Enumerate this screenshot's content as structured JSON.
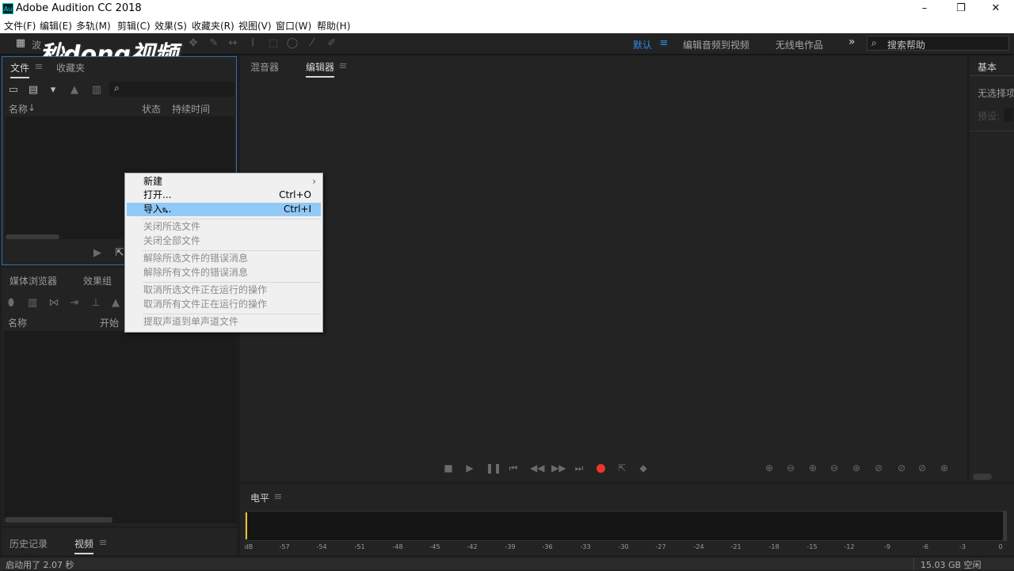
{
  "window": {
    "title": "Adobe Audition CC 2018",
    "app_icon": "Au",
    "minimize": "–",
    "maximize": "❐",
    "close": "✕"
  },
  "menu": [
    "文件(F)",
    "编辑(E)",
    "多轨(M)",
    "剪辑(C)",
    "效果(S)",
    "收藏夹(R)",
    "视图(V)",
    "窗口(W)",
    "帮助(H)"
  ],
  "toolbar": {
    "waveform_label": "波",
    "workspaces": [
      "默认",
      "编辑音频到视频",
      "无线电作品"
    ],
    "overflow": "»",
    "search_placeholder": "搜索帮助"
  },
  "watermark": "秒dong视频",
  "files_panel": {
    "tabs": [
      "文件",
      "收藏夹"
    ],
    "columns": [
      "名称",
      "状态",
      "持续时间"
    ]
  },
  "media_panel": {
    "tabs": [
      "媒体浏览器",
      "效果组"
    ],
    "columns": [
      "名称",
      "开始"
    ]
  },
  "history_panel": {
    "tabs": [
      "历史记录",
      "视频"
    ]
  },
  "editor_panel": {
    "tabs": [
      "混音器",
      "编辑器"
    ]
  },
  "essential_panel": {
    "title": "基本",
    "no_selection": "无选择项",
    "preset": "预设:"
  },
  "level_panel": {
    "title": "电平",
    "ticks": [
      "dB",
      "-57",
      "-54",
      "-51",
      "-48",
      "-45",
      "-42",
      "-39",
      "-36",
      "-33",
      "-30",
      "-27",
      "-24",
      "-21",
      "-18",
      "-15",
      "-12",
      "-9",
      "-6",
      "-3",
      "0"
    ]
  },
  "context_menu": {
    "items": [
      {
        "label": "新建",
        "shortcut": "›",
        "enabled": true
      },
      {
        "label": "打开...",
        "shortcut": "Ctrl+O",
        "enabled": true
      },
      {
        "label": "导入...",
        "shortcut": "Ctrl+I",
        "enabled": true,
        "highlighted": true
      },
      {
        "label": "关闭所选文件",
        "shortcut": "",
        "enabled": false
      },
      {
        "label": "关闭全部文件",
        "shortcut": "",
        "enabled": false
      },
      {
        "label": "解除所选文件的错误消息",
        "shortcut": "",
        "enabled": false
      },
      {
        "label": "解除所有文件的错误消息",
        "shortcut": "",
        "enabled": false
      },
      {
        "label": "取消所选文件正在运行的操作",
        "shortcut": "",
        "enabled": false
      },
      {
        "label": "取消所有文件正在运行的操作",
        "shortcut": "",
        "enabled": false
      },
      {
        "label": "提取声道到单声道文件",
        "shortcut": "",
        "enabled": false
      }
    ]
  },
  "status": {
    "left": "启动用了 2.07 秒",
    "right": "15.03 GB 空闲"
  },
  "colors": {
    "accent": "#2d8ceb",
    "record": "#e8382b",
    "playhead": "#e8c23a"
  }
}
